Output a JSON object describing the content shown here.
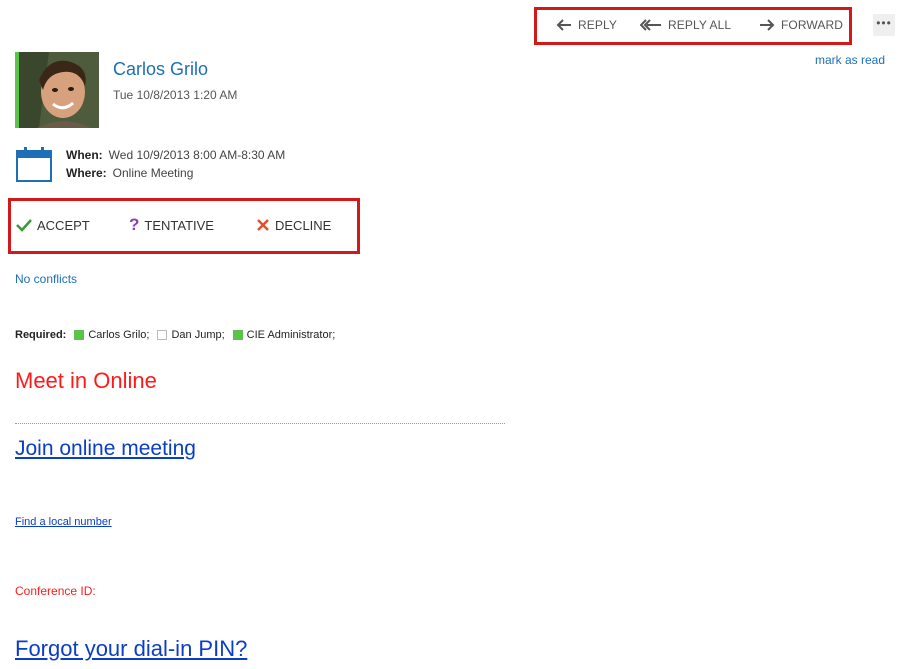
{
  "toolbar": {
    "reply_label": "REPLY",
    "reply_all_label": "REPLY ALL",
    "forward_label": "FORWARD",
    "more_label": "•••",
    "mark_as_read_label": "mark as read"
  },
  "sender": {
    "name": "Carlos Grilo",
    "date": "Tue 10/8/2013 1:20 AM",
    "presence_color": "#5cc34a"
  },
  "meeting": {
    "when_label": "When:",
    "when_value": "Wed 10/9/2013 8:00 AM-8:30 AM",
    "where_label": "Where:",
    "where_value": "Online Meeting"
  },
  "rsvp": {
    "accept_label": "ACCEPT",
    "tentative_label": "TENTATIVE",
    "decline_label": "DECLINE",
    "accept_color": "#3a9a3a",
    "tentative_color": "#8a3fb8",
    "decline_color": "#e0502a",
    "conflicts": "No conflicts"
  },
  "attendees": {
    "label": "Required:",
    "list": [
      {
        "name": "Carlos Grilo;",
        "status": "green"
      },
      {
        "name": "Dan Jump;",
        "status": "empty"
      },
      {
        "name": "CIE Administrator;",
        "status": "green"
      }
    ]
  },
  "body": {
    "title": "Meet in Online",
    "join_link": "Join online meeting",
    "find_number_link": "Find a local number",
    "conference_id_label": "Conference ID:",
    "forgot_pin_link": "Forgot your dial-in PIN?"
  },
  "icons": {
    "reply": "reply-arrow-icon",
    "reply_all": "reply-all-arrow-icon",
    "forward": "forward-arrow-icon",
    "calendar": "calendar-icon",
    "accept": "checkmark-icon",
    "tentative": "question-mark-icon",
    "decline": "x-mark-icon"
  }
}
